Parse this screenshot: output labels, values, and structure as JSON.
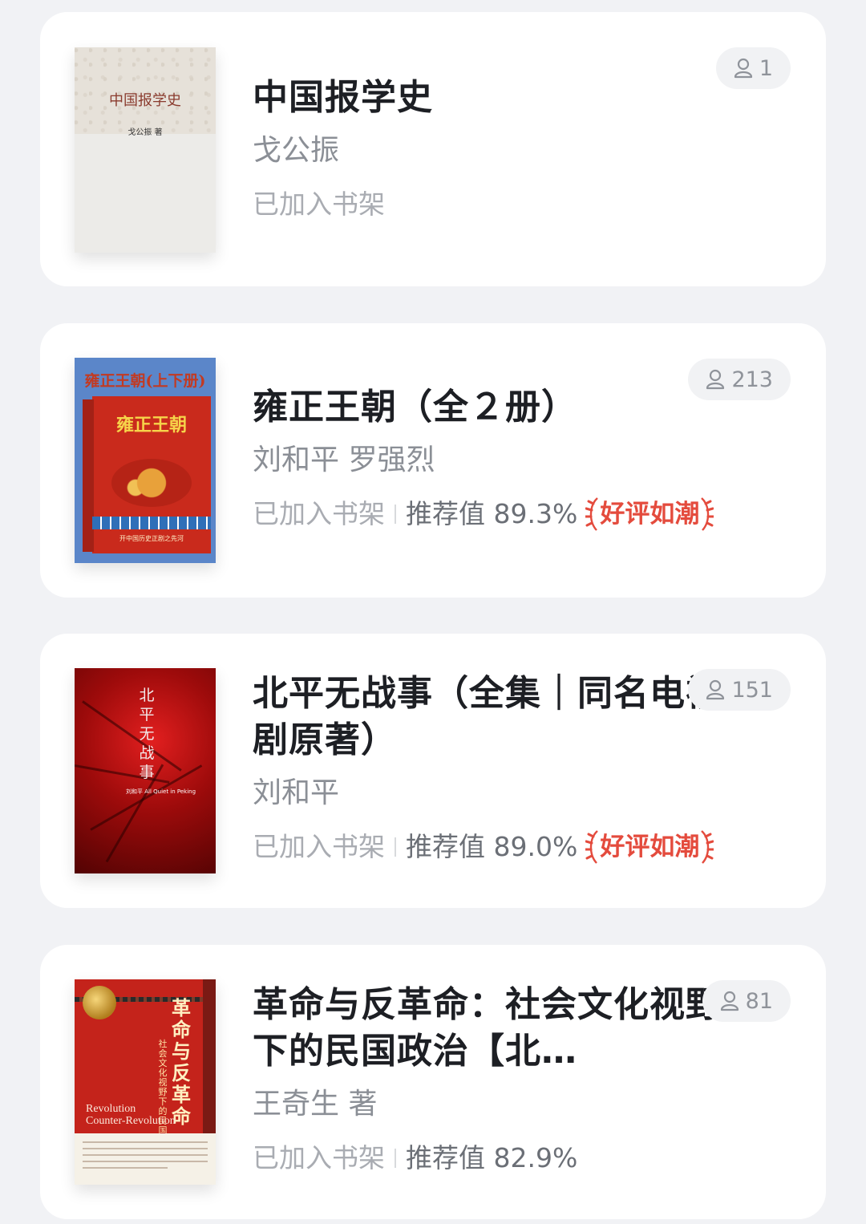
{
  "books": [
    {
      "title": "中国报学史",
      "author": "戈公振",
      "shelf_status": "已加入书架",
      "readers": "1",
      "cover": {
        "title_text": "中国报学史",
        "author_text": "戈公振 著"
      }
    },
    {
      "title": "雍正王朝（全２册）",
      "author": "刘和平 罗强烈",
      "shelf_status": "已加入书架",
      "recommend_label": "推荐值 89.3%",
      "badge_text": "好评如潮",
      "readers": "213",
      "cover": {
        "top_text": "雍正王朝(上下册)",
        "name_text": "雍正王朝",
        "slogan_text": "开中国历史正剧之先河"
      }
    },
    {
      "title": "北平无战事（全集｜同名电视剧原著）",
      "author": "刘和平",
      "shelf_status": "已加入书架",
      "recommend_label": "推荐值 89.0%",
      "badge_text": "好评如潮",
      "readers": "151",
      "cover": {
        "vertical_title": "北平无战事",
        "small_text": "刘和平 All Quiet in Peking"
      }
    },
    {
      "title": "革命与反革命：社会文化视野下的民国政治【北…",
      "author": "王奇生 著",
      "shelf_status": "已加入书架",
      "recommend_label": "推荐值 82.9%",
      "readers": "81",
      "cover": {
        "big_text": "革命与反革命",
        "sub_text": "社会文化视野下的民国政治",
        "en_line1": "Revolution",
        "en_line2": "Counter-Revolution"
      }
    }
  ],
  "colors": {
    "background": "#f1f2f5",
    "card": "#ffffff",
    "title": "#1d1f24",
    "muted": "#a9acb2",
    "badge": "#e44b3d"
  }
}
